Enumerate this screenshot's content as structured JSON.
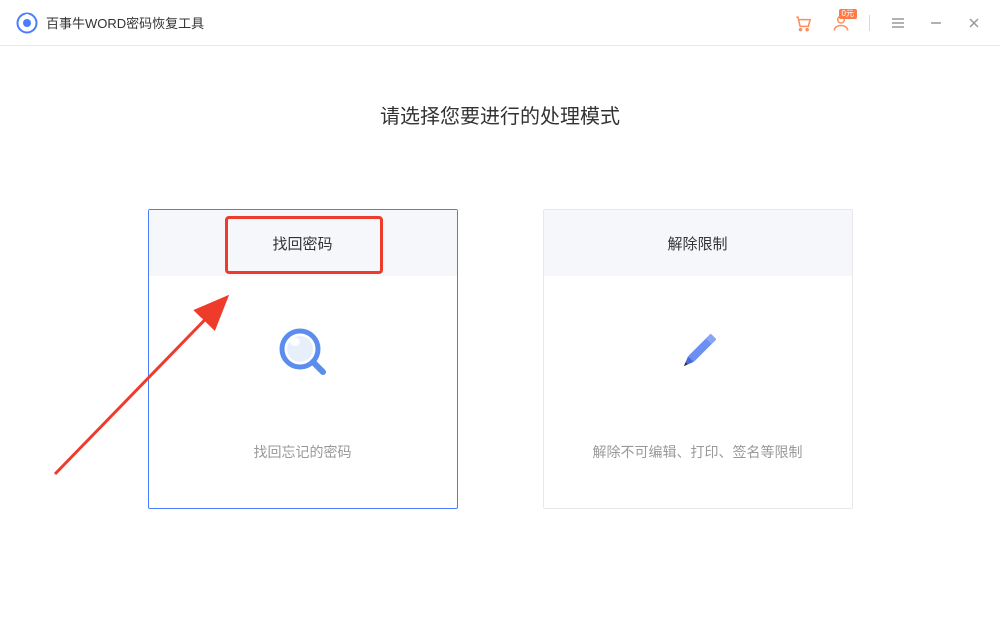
{
  "app": {
    "title": "百事牛WORD密码恢复工具"
  },
  "page": {
    "heading": "请选择您要进行的处理模式"
  },
  "cards": {
    "recover": {
      "title": "找回密码",
      "desc": "找回忘记的密码"
    },
    "unlock": {
      "title": "解除限制",
      "desc": "解除不可编辑、打印、签名等限制"
    }
  },
  "user_badge": "0元"
}
